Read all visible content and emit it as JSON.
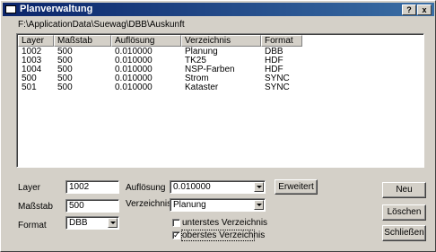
{
  "window": {
    "title": "Planverwaltung",
    "help_label": "?",
    "close_label": "x"
  },
  "path": "F:\\ApplicationData\\Suewag\\DBB\\Auskunft",
  "table": {
    "columns": [
      "Layer",
      "Maßstab",
      "Auflösung",
      "Verzeichnis",
      "Format"
    ],
    "rows": [
      [
        "1002",
        "500",
        "0.010000",
        "Planung",
        "DBB"
      ],
      [
        "1003",
        "500",
        "0.010000",
        "TK25",
        "HDF"
      ],
      [
        "1004",
        "500",
        "0.010000",
        "NSP-Farben",
        "HDF"
      ],
      [
        "500",
        "500",
        "0.010000",
        "Strom",
        "SYNC"
      ],
      [
        "501",
        "500",
        "0.010000",
        "Kataster",
        "SYNC"
      ]
    ]
  },
  "form": {
    "layer_label": "Layer",
    "layer_value": "1002",
    "massstab_label": "Maßstab",
    "massstab_value": "500",
    "format_label": "Format",
    "format_value": "DBB",
    "aufloesung_label": "Auflösung",
    "aufloesung_value": "0.010000",
    "verzeichnis_label": "Verzeichnis",
    "verzeichnis_value": "Planung",
    "erweitert_label": "Erweitert",
    "unterstes_label": "unterstes Verzeichnis",
    "unterstes_checked": false,
    "oberstes_label": "oberstes Verzeichnis",
    "oberstes_checked": true,
    "check_mark": "✓"
  },
  "buttons": {
    "neu": "Neu",
    "loeschen": "Löschen",
    "schliessen": "Schließen"
  },
  "colors": {
    "title_active_start": "#0a246a",
    "title_active_end": "#3a6ea5",
    "face": "#d4d0c8"
  }
}
